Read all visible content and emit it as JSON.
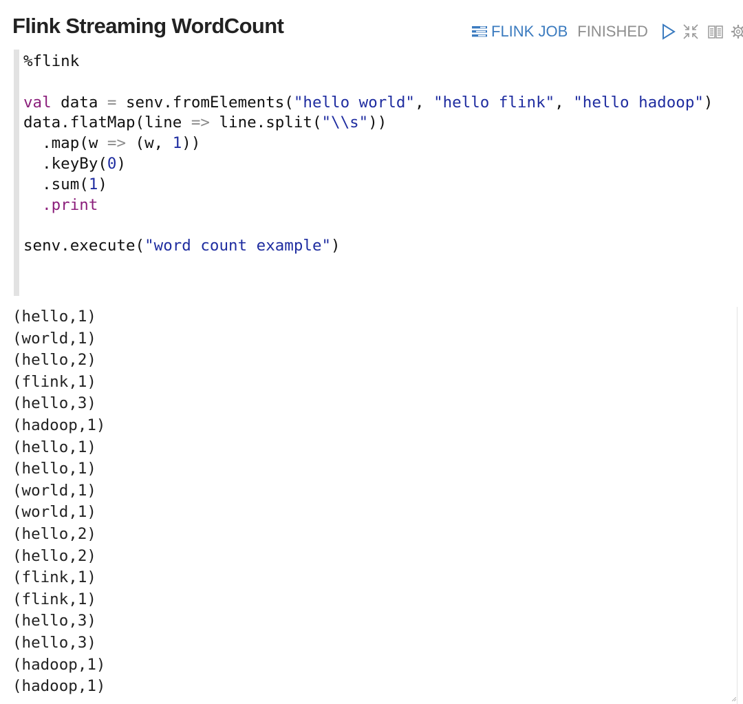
{
  "paragraph": {
    "title": "Flink Streaming WordCount",
    "job_link_label": "FLINK JOB",
    "status": "FINISHED"
  },
  "code": {
    "line1": "%flink",
    "line3_kw": "val",
    "line3_a": " data ",
    "line3_op": "=",
    "line3_b": " senv.fromElements(",
    "line3_s1": "\"hello world\"",
    "line3_c1": ", ",
    "line3_s2": "\"hello flink\"",
    "line3_c2": ", ",
    "line3_s3": "\"hello hadoop\"",
    "line3_end": ")",
    "line4_a": "data.flatMap(line ",
    "line4_op": "=>",
    "line4_b": " line.split(",
    "line4_s": "\"\\\\s\"",
    "line4_end": "))",
    "line5_a": "  .map(w ",
    "line5_op": "=>",
    "line5_b": " (w, ",
    "line5_n": "1",
    "line5_end": "))",
    "line6_a": "  .keyBy(",
    "line6_n": "0",
    "line6_end": ")",
    "line7_a": "  .sum(",
    "line7_n": "1",
    "line7_end": ")",
    "line8_a": "  ",
    "line8_kw": ".print",
    "line10_a": "senv.execute(",
    "line10_s": "\"word count example\"",
    "line10_end": ")"
  },
  "output": {
    "lines": [
      "(hello,1)",
      "(world,1)",
      "(hello,2)",
      "(flink,1)",
      "(hello,3)",
      "(hadoop,1)",
      "(hello,1)",
      "(hello,1)",
      "(world,1)",
      "(world,1)",
      "(hello,2)",
      "(hello,2)",
      "(flink,1)",
      "(flink,1)",
      "(hello,3)",
      "(hello,3)",
      "(hadoop,1)",
      "(hadoop,1)"
    ]
  },
  "colors": {
    "link": "#3b7bbf",
    "status": "#8e8e8e",
    "keyword": "#8b1f7b",
    "string": "#1f2da0",
    "icon": "#3b7bbf",
    "icon_muted": "#9a9a9a"
  },
  "icons": {
    "job": "tasks-list-icon",
    "run": "play-icon",
    "collapse": "compress-icon",
    "book": "book-icon",
    "settings": "gear-icon"
  }
}
